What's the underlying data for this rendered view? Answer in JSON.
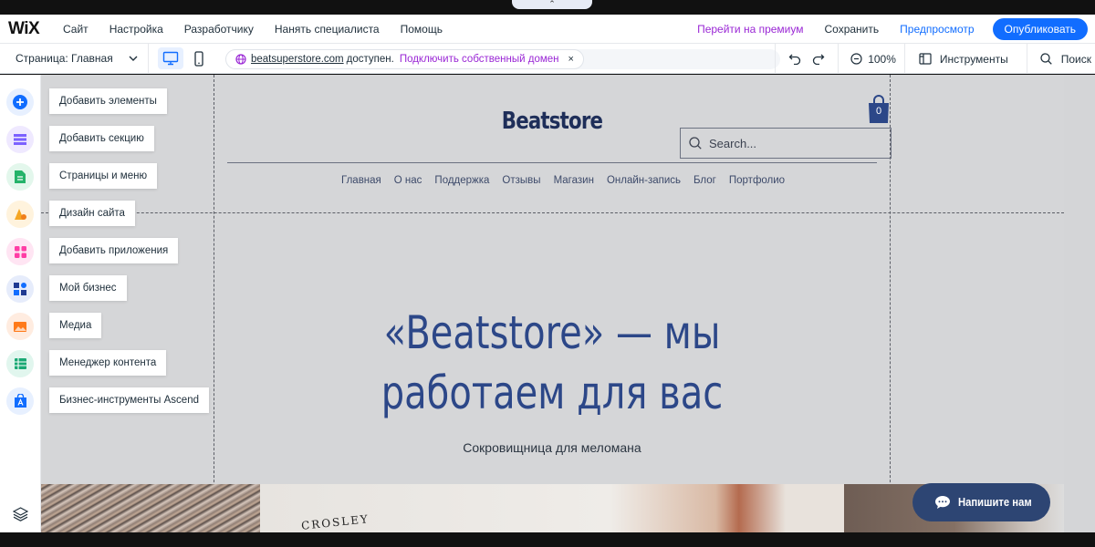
{
  "brand": {
    "logo": "WiX"
  },
  "top_menu": [
    "Сайт",
    "Настройка",
    "Разработчику",
    "Нанять специалиста",
    "Помощь"
  ],
  "top_actions": {
    "premium": "Перейти на премиум",
    "save": "Сохранить",
    "preview": "Предпросмотр",
    "publish": "Опубликовать"
  },
  "toolbar": {
    "page_label": "Страница: Главная",
    "domain": "beatsuperstore.com",
    "available": "доступен.",
    "connect": "Подключить собственный домен",
    "close": "×",
    "zoom": "100%",
    "tools": "Инструменты",
    "search": "Поиск"
  },
  "left_panel": {
    "items": [
      {
        "label": "Добавить элементы",
        "icon": "plus-icon",
        "color": "#116dff"
      },
      {
        "label": "Добавить секцию",
        "icon": "section-icon",
        "color": "#7b61ff"
      },
      {
        "label": "Страницы и меню",
        "icon": "pages-icon",
        "color": "#25b36a"
      },
      {
        "label": "Дизайн сайта",
        "icon": "design-icon",
        "color": "#f5a623"
      },
      {
        "label": "Добавить приложения",
        "icon": "apps-icon",
        "color": "#ff3da5"
      },
      {
        "label": "Мой бизнес",
        "icon": "business-icon",
        "color": "#1f3a93"
      },
      {
        "label": "Медиа",
        "icon": "media-icon",
        "color": "#ff7a1a"
      },
      {
        "label": "Менеджер контента",
        "icon": "cms-icon",
        "color": "#19a974"
      },
      {
        "label": "Бизнес-инструменты Ascend",
        "icon": "ascend-icon",
        "color": "#116dff"
      }
    ]
  },
  "site": {
    "title": "Beatstore",
    "cart_count": "0",
    "search_placeholder": "Search...",
    "nav": [
      "Главная",
      "О нас",
      "Поддержка",
      "Отзывы",
      "Магазин",
      "Онлайн-запись",
      "Блог",
      "Портфолио"
    ],
    "hero_line1": "«Beatstore» — мы",
    "hero_line2": "работаем для вас",
    "hero_sub": "Сокровищница для меломана",
    "image_text": "CROSLEY",
    "chat_label": "Напишите нам"
  }
}
